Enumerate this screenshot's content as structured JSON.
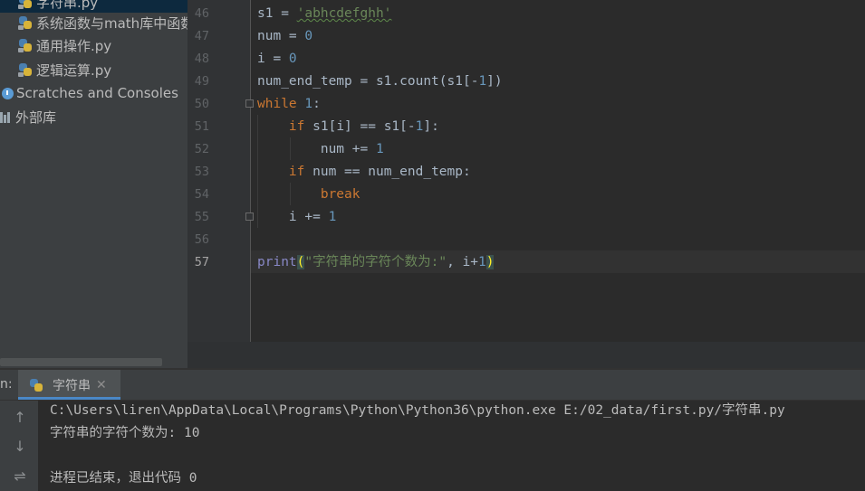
{
  "project_tree": {
    "items": [
      {
        "label": "字符串.py",
        "type": "file"
      },
      {
        "label": "系统函数与math库中函数",
        "type": "file"
      },
      {
        "label": "通用操作.py",
        "type": "file"
      },
      {
        "label": "逻辑运算.py",
        "type": "file"
      },
      {
        "label": "Scratches and Consoles",
        "type": "scratches"
      },
      {
        "label": "外部库",
        "type": "library"
      }
    ]
  },
  "editor": {
    "line_numbers": [
      "46",
      "47",
      "48",
      "49",
      "50",
      "51",
      "52",
      "53",
      "54",
      "55",
      "56",
      "57"
    ],
    "current_line": "57",
    "lines": [
      {
        "p1": "s1 = ",
        "str": "'abhcdefghh'"
      },
      {
        "p1": "num = ",
        "num": "0"
      },
      {
        "p1": "i = ",
        "num": "0"
      },
      {
        "p1": "num_end_temp = s1.count(s1[-",
        "num": "1",
        "p2": "])"
      },
      {
        "kw": "while ",
        "num": "1",
        "p2": ":"
      },
      {
        "indent": "    ",
        "kw": "if ",
        "p1": "s1[i] == s1[-",
        "num": "1",
        "p2": "]:"
      },
      {
        "indent": "        ",
        "p1": "num += ",
        "num": "1"
      },
      {
        "indent": "    ",
        "kw": "if ",
        "p1": "num == num_end_temp:"
      },
      {
        "indent": "        ",
        "kw": "break"
      },
      {
        "indent": "    ",
        "p1": "i += ",
        "num": "1"
      },
      {},
      {
        "builtin": "print",
        "open": "(",
        "str": "\"字符串的字符个数为:\"",
        "p1": ", i+",
        "num": "1",
        "close": ")"
      }
    ]
  },
  "run_panel": {
    "label": "n:",
    "tab_label": "字符串",
    "tab_close": "✕",
    "toolbar": {
      "up": "↑",
      "down": "↓",
      "wrap": "⇌"
    },
    "console": [
      "C:\\Users\\liren\\AppData\\Local\\Programs\\Python\\Python36\\python.exe E:/02_data/first.py/字符串.py",
      "字符串的字符个数为: 10",
      "",
      "进程已结束，退出代码 0"
    ]
  },
  "colors": {
    "keyword": "#cc7832",
    "number": "#6897bb",
    "string": "#6a8759",
    "builtin": "#8888c6",
    "selection": "#0d293e",
    "tab_underline": "#4a88c7"
  },
  "icons": [
    "python-file-icon",
    "scratches-icon",
    "library-icon",
    "close-icon",
    "arrow-up-icon",
    "arrow-down-icon",
    "soft-wrap-icon"
  ]
}
